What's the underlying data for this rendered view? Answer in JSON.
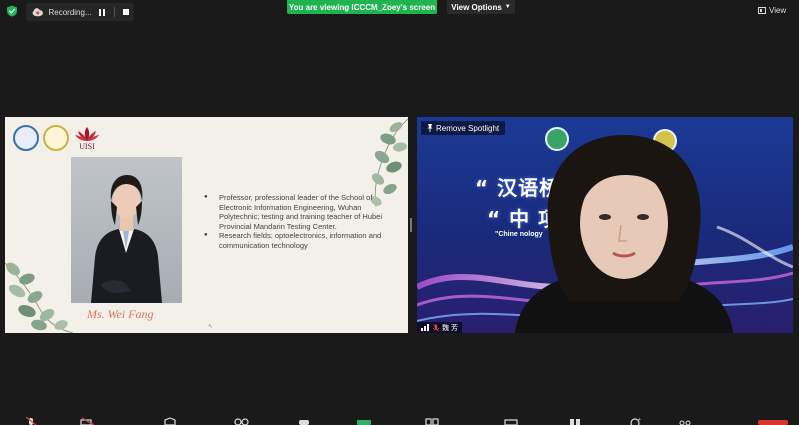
{
  "topbar": {
    "recording_label": "Recording...",
    "viewing_banner": "You are viewing ICCCM_Zoey's screen",
    "view_options_label": "View Options",
    "view_label": "View"
  },
  "slide": {
    "uisi_logo_text": "UISI",
    "speaker_name": "Ms. Wei Fang",
    "bullets": [
      "Professor, professional leader of the School of Electronic Information Engineering, Wuhan Polytechnic; testing and training teacher of Hubei Provincial Mandarin Testing Center.",
      "Research fields: optoelectronics, information and communication technology"
    ]
  },
  "video": {
    "remove_spotlight_label": "Remove Spotlight",
    "banner_line1": "“ 汉语桥        信技术",
    "banner_line2": "“ 中                 项目",
    "banner_english": "\"Chine                                        nology",
    "participant_name": "魏 芳"
  },
  "colors": {
    "viewing_banner": "#1fb450",
    "slide_background": "#f3efe9",
    "speaker_name": "#d4765c",
    "window_background": "#1a1a1a"
  }
}
